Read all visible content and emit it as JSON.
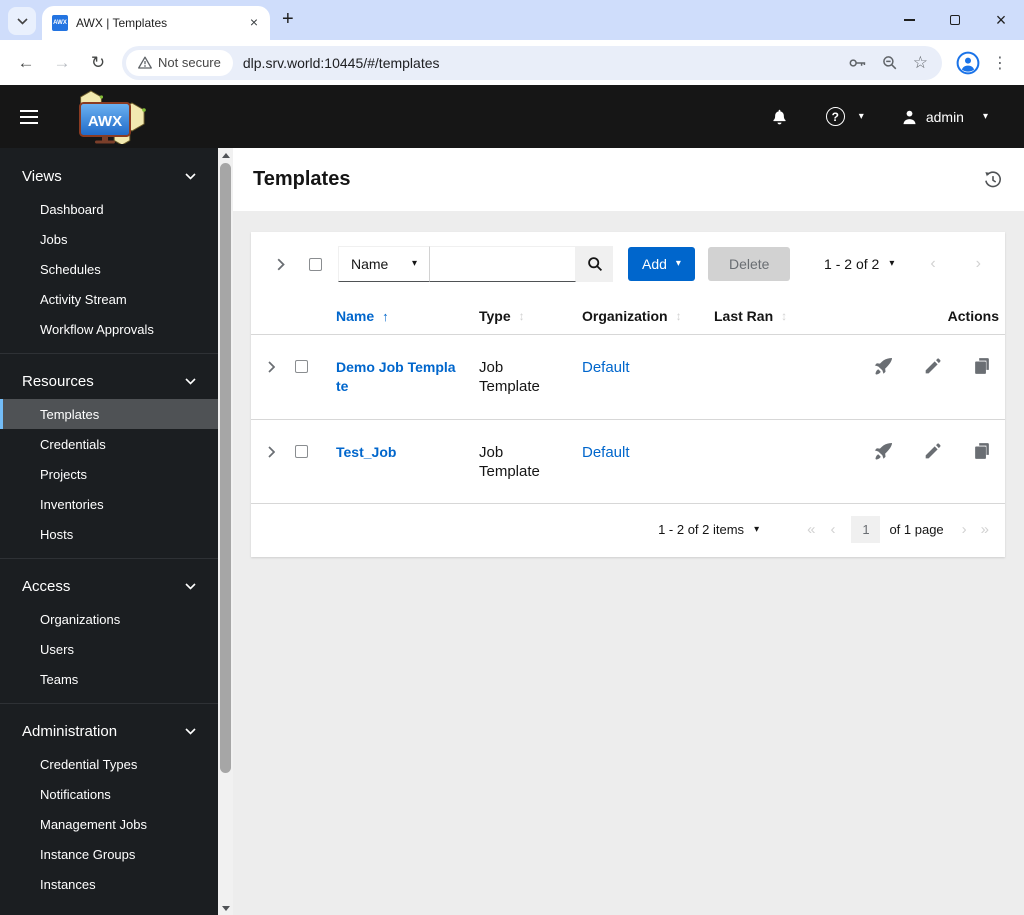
{
  "browser": {
    "tab_title": "AWX | Templates",
    "favicon_text": "AWX",
    "not_secure_label": "Not secure",
    "url": "dlp.srv.world:10445/#/templates"
  },
  "topbar": {
    "brand": "AWX",
    "user": "admin"
  },
  "sidebar": {
    "sections": [
      {
        "label": "Views",
        "items": [
          "Dashboard",
          "Jobs",
          "Schedules",
          "Activity Stream",
          "Workflow Approvals"
        ]
      },
      {
        "label": "Resources",
        "items": [
          "Templates",
          "Credentials",
          "Projects",
          "Inventories",
          "Hosts"
        ],
        "active_item": "Templates"
      },
      {
        "label": "Access",
        "items": [
          "Organizations",
          "Users",
          "Teams"
        ]
      },
      {
        "label": "Administration",
        "items": [
          "Credential Types",
          "Notifications",
          "Management Jobs",
          "Instance Groups",
          "Instances"
        ]
      }
    ]
  },
  "page": {
    "title": "Templates"
  },
  "toolbar": {
    "filter_label": "Name",
    "search_value": "",
    "add_label": "Add",
    "delete_label": "Delete",
    "range_label": "1 - 2 of 2"
  },
  "table": {
    "columns": [
      "Name",
      "Type",
      "Organization",
      "Last Ran",
      "Actions"
    ],
    "rows": [
      {
        "name": "Demo Job Template",
        "type": "Job Template",
        "organization": "Default",
        "last_ran": ""
      },
      {
        "name": "Test_Job",
        "type": "Job Template",
        "organization": "Default",
        "last_ran": ""
      }
    ]
  },
  "pagination": {
    "summary": "1 - 2 of 2 items",
    "current_page": "1",
    "of_label": "of 1 page"
  },
  "icons": {
    "caret_down": "▾",
    "sort_asc": "↑",
    "sort_both": "↕",
    "angle_left": "‹",
    "angle_right": "›",
    "angle_double_left": "«",
    "angle_double_right": "»",
    "back_arrow": "←",
    "forward_arrow": "→",
    "reload": "↻",
    "kebab": "⋮",
    "star": "☆",
    "plus": "+",
    "question_mark": "?",
    "close": "×"
  },
  "colors": {
    "accent_blue": "#0066cc",
    "link_blue": "#0066cc",
    "sidebar_active_border": "#73bcf7",
    "topbar_bg": "#161616",
    "titlebar_bg": "#cfddfb",
    "disabled_gray": "#d2d2d2"
  }
}
